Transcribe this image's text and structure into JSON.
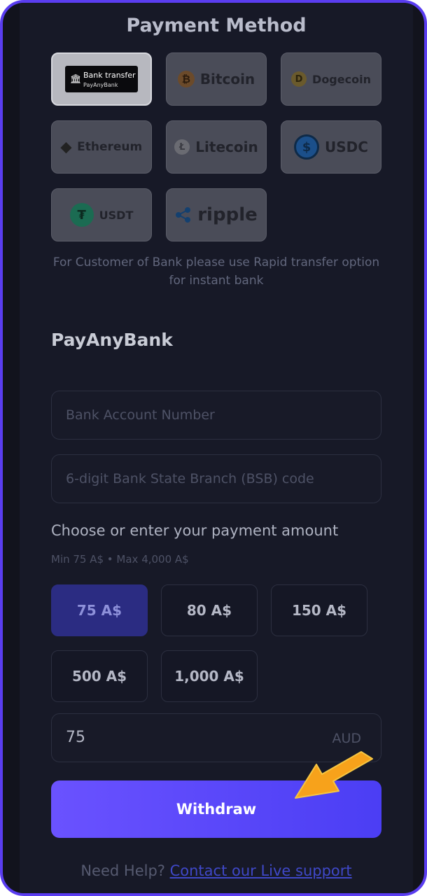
{
  "header": {
    "title": "Payment Method"
  },
  "payment_methods": [
    {
      "label": "Bank transfer",
      "sublabel": "PayAnyBank",
      "icon": "bank-icon",
      "active": true
    },
    {
      "label": "Bitcoin",
      "icon": "bitcoin-icon",
      "color": "#c9812a"
    },
    {
      "label": "Dogecoin",
      "icon": "dogecoin-icon",
      "color": "#b89a3a"
    },
    {
      "label": "Ethereum",
      "icon": "ethereum-icon",
      "color": "#2b2b2b"
    },
    {
      "label": "Litecoin",
      "icon": "litecoin-icon",
      "color": "#7a7a7a"
    },
    {
      "label": "USDC",
      "icon": "usdc-icon",
      "color": "#2775ca"
    },
    {
      "label": "USDT",
      "icon": "usdt-icon",
      "color": "#26a17b"
    },
    {
      "label": "ripple",
      "icon": "ripple-icon",
      "color": "#1f5fa5"
    }
  ],
  "hint": "For Customer of Bank please use Rapid transfer option for instant bank",
  "section_title": "PayAnyBank",
  "fields": {
    "account_placeholder": "Bank Account Number",
    "bsb_placeholder": "6-digit Bank State Branch (BSB) code"
  },
  "amount": {
    "prompt": "Choose or enter your payment amount",
    "limits": "Min 75 A$ • Max 4,000 A$",
    "options": [
      "75 A$",
      "80 A$",
      "150 A$",
      "500 A$",
      "1,000 A$"
    ],
    "selected_index": 0,
    "value": "75",
    "currency": "AUD"
  },
  "withdraw_label": "Withdraw",
  "help": {
    "text": "Need Help?",
    "link": "Contact our Live support"
  },
  "colors": {
    "accent": "#5b47fa",
    "arrow": "#f7a21b",
    "frame": "#5a3df0"
  }
}
